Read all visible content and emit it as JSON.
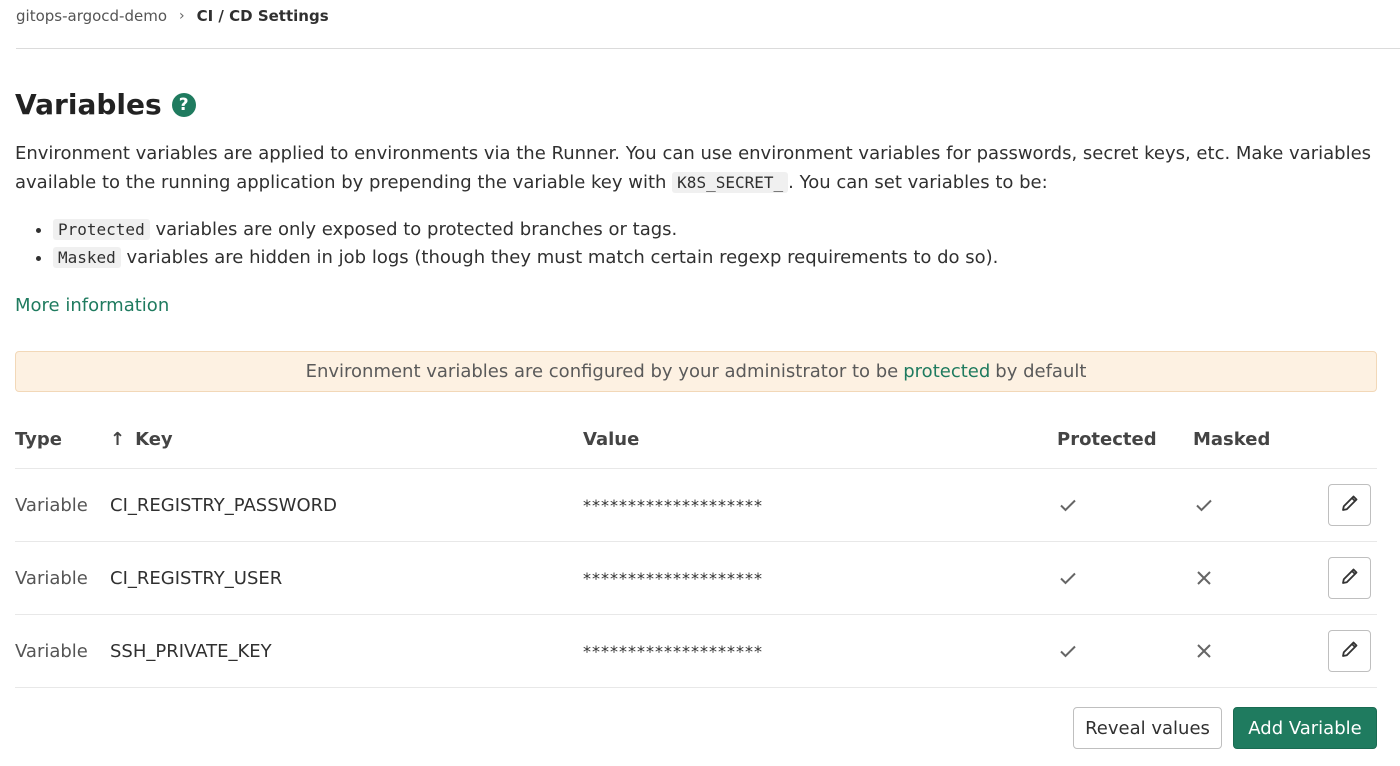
{
  "breadcrumb": {
    "project": "gitops-argocd-demo",
    "separator": "›",
    "current": "CI / CD Settings"
  },
  "section": {
    "title": "Variables",
    "help_icon": "?",
    "description_part1": "Environment variables are applied to environments via the Runner. You can use environment variables for passwords, secret keys, etc. Make variables available to the running application by prepending the variable key with",
    "description_code": "K8S_SECRET_",
    "description_part2": ". You can set variables to be:",
    "bullets": [
      {
        "code": "Protected",
        "text": "variables are only exposed to protected branches or tags."
      },
      {
        "code": "Masked",
        "text": "variables are hidden in job logs (though they must match certain regexp requirements to do so)."
      }
    ],
    "more_info": "More information"
  },
  "alert": {
    "before": "Environment variables are configured by your administrator to be",
    "link": "protected",
    "after": "by default"
  },
  "table": {
    "columns": {
      "type": "Type",
      "sort_arrow": "↑",
      "key": "Key",
      "value": "Value",
      "protected": "Protected",
      "masked": "Masked"
    },
    "rows": [
      {
        "type": "Variable",
        "key": "CI_REGISTRY_PASSWORD",
        "value": "********************",
        "protected": true,
        "masked": true
      },
      {
        "type": "Variable",
        "key": "CI_REGISTRY_USER",
        "value": "********************",
        "protected": true,
        "masked": false
      },
      {
        "type": "Variable",
        "key": "SSH_PRIVATE_KEY",
        "value": "********************",
        "protected": true,
        "masked": false
      }
    ]
  },
  "buttons": {
    "reveal": "Reveal values",
    "add": "Add Variable"
  },
  "colors": {
    "accent": "#1f7b5f",
    "alert_bg": "#fdf1e2"
  }
}
